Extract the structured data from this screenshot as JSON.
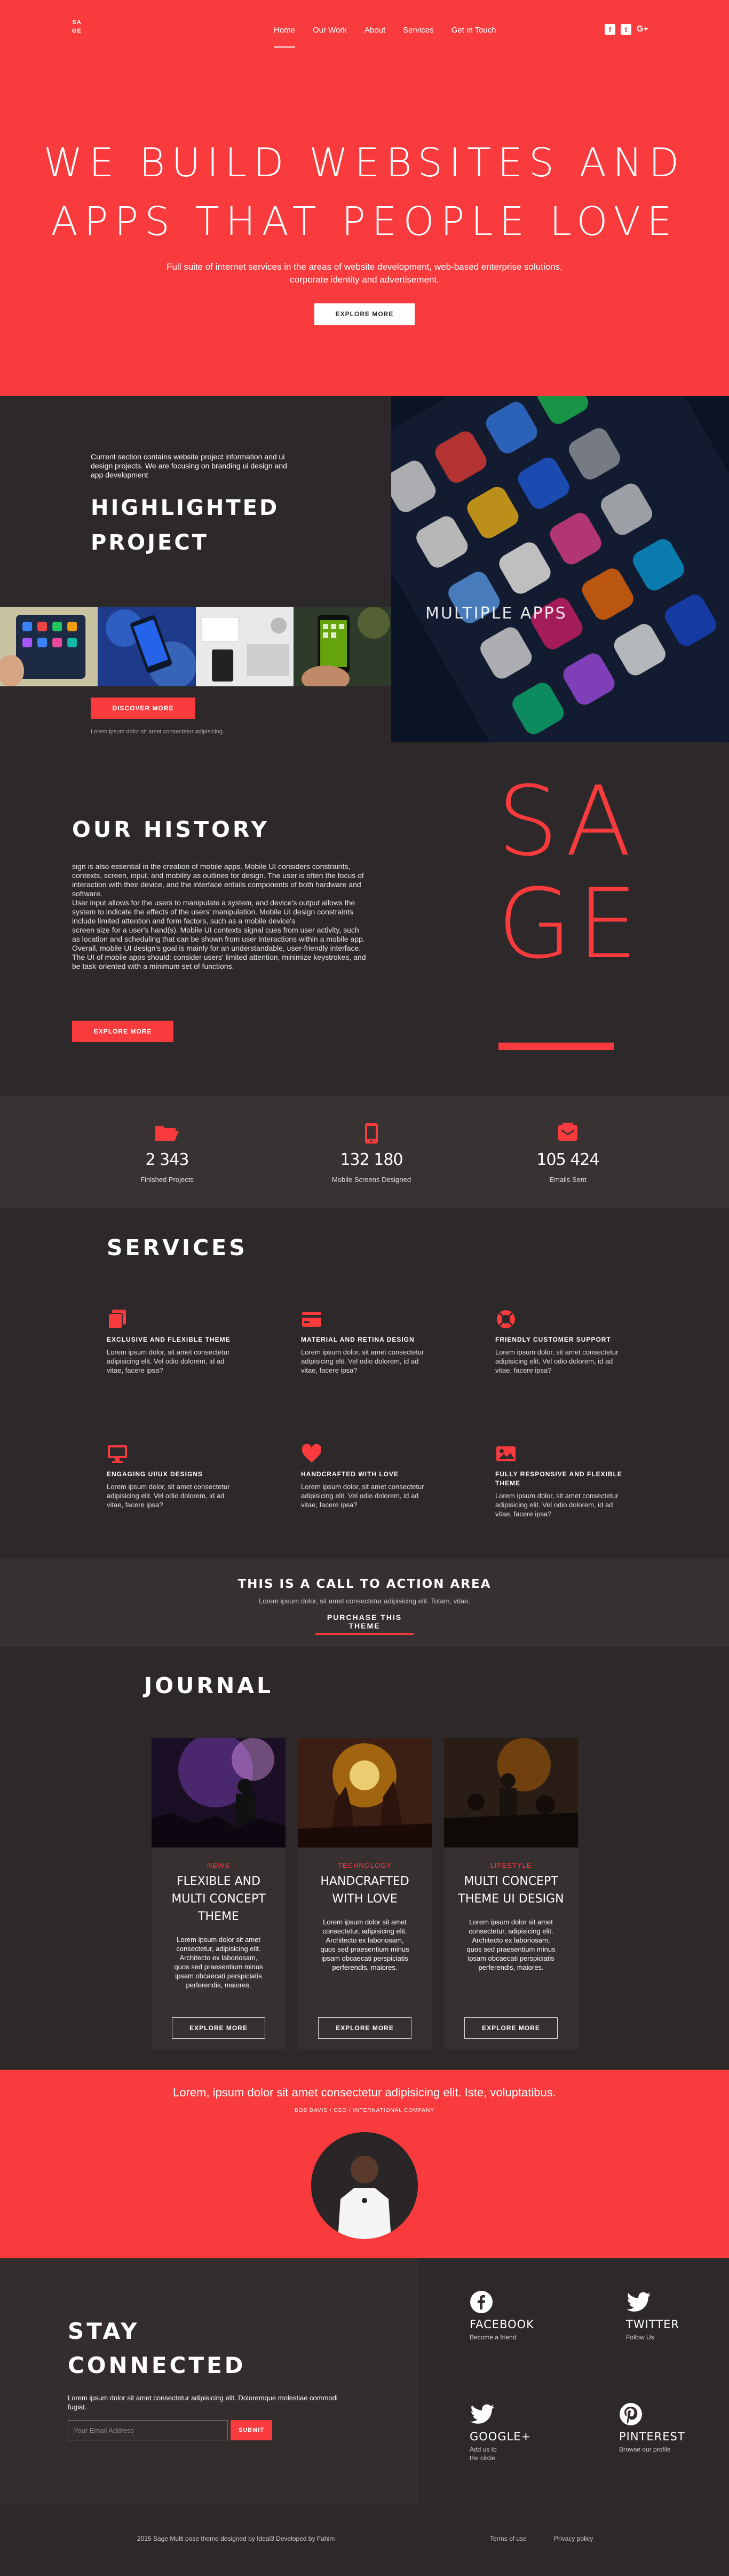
{
  "header": {
    "logo_line1": "SA",
    "logo_line2": "GE",
    "nav": [
      "Home",
      "Our Work",
      "About",
      "Services",
      "Get in Touch"
    ],
    "social_icons": [
      "facebook-icon",
      "twitter-icon",
      "google-plus-icon"
    ]
  },
  "hero": {
    "title_line1": "WE BUILD WEBSITES AND",
    "title_line2": "APPS THAT PEOPLE LOVE",
    "subtitle_line1": "Full suite of internet services in the areas of website development, web-based enterprise solutions,",
    "subtitle_line2": "corporate identity and advertisement.",
    "button": "EXPLORE MORE"
  },
  "project": {
    "description": "Current section contains website project information and ui design projects. We are focusing on branding ui design and app development",
    "title_line1": "HIGHLIGHTED",
    "title_line2": "PROJECT",
    "button": "DISCOVER MORE",
    "note": "Lorem ipsum dolor sit amet consectetur adipisicing.",
    "image_label": "MULTIPLE APPS"
  },
  "history": {
    "title": "OUR HISTORY",
    "body": "sign is also essential in the creation of mobile apps. Mobile UI considers constraints, contexts, screen, input, and mobility as outlines for design. The user is often the focus of interaction with their device, and the interface entails components of both hardware and software.\nUser input allows for the users to manipulate a system, and device's output allows the system to indicate the effects of the users' manipulation. Mobile UI design constraints include limited attention and form factors, such as a mobile device's\nscreen size for a user's hand(s). Mobile UI contexts signal cues from user activity, such as location and scheduling that can be shown from user interactions within a mobile app. Overall, mobile UI design's goal is mainly for an understandable, user-friendly interface. The UI of mobile apps should: consider users' limited attention, minimize keystrokes, and be task-oriented with a minimum set of functions.",
    "button": "EXPLORE MORE",
    "brand_line1": "SA",
    "brand_line2": "GE"
  },
  "stats": [
    {
      "icon": "folder-open-icon",
      "value": "2 343",
      "label": "Finished Projects"
    },
    {
      "icon": "mobile-icon",
      "value": "132 180",
      "label": "Mobile Screens Designed"
    },
    {
      "icon": "envelope-icon",
      "value": "105 424",
      "label": "Emails Sent"
    }
  ],
  "services": {
    "title": "SERVICES",
    "items": [
      {
        "icon": "copy-icon",
        "title": "EXCLUSIVE AND FLEXIBLE THEME",
        "desc": "Lorem ipsum dolor, sit amet consectetur adipisicing elit. Vel odio dolorem, id ad vitae, facere ipsa?"
      },
      {
        "icon": "credit-card-icon",
        "title": "MATERIAL AND RETINA DESIGN",
        "desc": "Lorem ipsum dolor, sit amet consectetur adipisicing elit. Vel odio dolorem, id ad vitae, facere ipsa?"
      },
      {
        "icon": "life-ring-icon",
        "title": "FRIENDLY CUSTOMER SUPPORT",
        "desc": "Lorem ipsum dolor, sit amet consectetur adipisicing elit. Vel odio dolorem, id ad vitae, facere ipsa?"
      },
      {
        "icon": "desktop-icon",
        "title": "ENGAGING UI/UX DESIGNS",
        "desc": "Lorem ipsum dolor, sit amet consectetur adipisicing elit. Vel odio dolorem, id ad vitae, facere ipsa?"
      },
      {
        "icon": "heart-icon",
        "title": "HANDCRAFTED WITH LOVE",
        "desc": "Lorem ipsum dolor, sit amet consectetur adipisicing elit. Vel odio dolorem, id ad vitae, facere ipsa?"
      },
      {
        "icon": "image-icon",
        "title": "FULLY RESPONSIVE AND FLEXIBLE THEME",
        "desc": "Lorem ipsum dolor, sit amet consectetur adipisicing elit. Vel odio dolorem, id ad vitae, facere ipsa?"
      }
    ]
  },
  "cta": {
    "title": "THIS IS A CALL TO ACTION AREA",
    "subtitle": "Lorem ipsum dolor, sit amet consectetur adipisicing elit. Totam, vitae.",
    "link": "PURCHASE THIS THEME"
  },
  "journal": {
    "title": "JOURNAL",
    "cards": [
      {
        "category": "NEWS",
        "title": "FLEXIBLE AND MULTI CONCEPT THEME",
        "desc": "Lorem ipsum dolor sit amet consectetur, adipisicing elit. Architecto ex laboriosam, quos sed praesentium minus ipsam obcaecati perspiciatis perferendis, maiores.",
        "button": "EXPLORE MORE"
      },
      {
        "category": "TECHNOLOGY",
        "title": "HANDCRAFTED WITH LOVE",
        "desc": "Lorem ipsum dolor sit amet consectetur, adipisicing elit. Architecto ex laboriosam, quos sed praesentium minus ipsam obcaecati perspiciatis perferendis, maiores.",
        "button": "EXPLORE MORE"
      },
      {
        "category": "LIFESTYLE",
        "title": "MULTI CONCEPT THEME UI DESIGN",
        "desc": "Lorem ipsum dolor sit amet consectetur, adipisicing elit. Architecto ex laboriosam, quos sed praesentium minus ipsam obcaecati perspiciatis perferendis, maiores.",
        "button": "EXPLORE MORE"
      }
    ]
  },
  "testimonial": {
    "quote": "Lorem, ipsum dolor sit amet consectetur adipisicing elit. Iste, voluptatibus.",
    "author": "BOB DAVIS / CEO / INTERNATIONAL COMPANY"
  },
  "stay": {
    "title_line1": "STAY",
    "title_line2": "CONNECTED",
    "desc": "Lorem ipsum dolor sit amet consectetur adipisicing elit. Doloremque molestiae commodi fugiat.",
    "email_placeholder": "Your Email Address",
    "submit": "SUBMIT",
    "social": [
      {
        "icon": "facebook-icon",
        "name": "FACEBOOK",
        "desc": "Become a friend"
      },
      {
        "icon": "twitter-icon",
        "name": "TWITTER",
        "desc": "Follow Us"
      },
      {
        "icon": "twitter-icon",
        "name": "GOOGLE+",
        "desc": "Add us to the circle"
      },
      {
        "icon": "pinterest-icon",
        "name": "PINTEREST",
        "desc": "Browse our profile"
      }
    ]
  },
  "footer": {
    "copyright": "2015 Sage Multi pose theme designed by Ideal3 Developed by Fahim",
    "links": [
      "Terms of use",
      "Privacy policy"
    ]
  },
  "colors": {
    "accent": "#f93b3e",
    "dark": "#2d2829"
  }
}
